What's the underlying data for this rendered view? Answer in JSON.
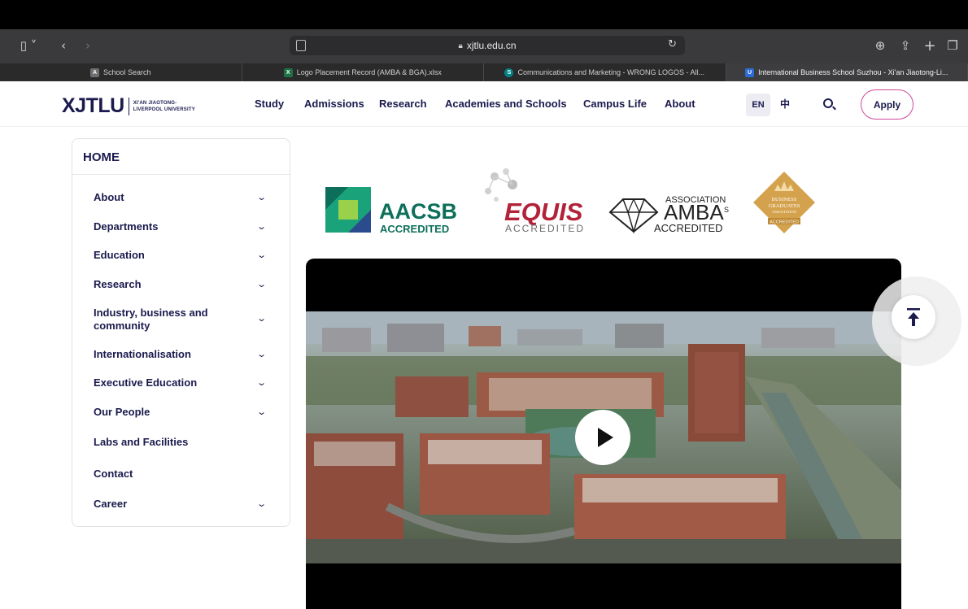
{
  "browser": {
    "url": "xjtlu.edu.cn",
    "tabs": [
      {
        "label": "School Search",
        "favicon_letter": "A",
        "favicon_color": "#6d6d72"
      },
      {
        "label": "Logo Placement Record (AMBA & BGA).xlsx",
        "favicon_letter": "X",
        "favicon_color": "#1e7145"
      },
      {
        "label": "Communications and Marketing - WRONG LOGOS - All...",
        "favicon_letter": "S",
        "favicon_color": "#038387"
      },
      {
        "label": "International Business School Suzhou - Xi'an Jiaotong-Li...",
        "favicon_letter": "U",
        "favicon_color": "#2b6cd4"
      }
    ]
  },
  "site": {
    "logo_main": "XJTLU",
    "logo_sub_1": "XI'AN JIAOTONG-",
    "logo_sub_2": "LIVERPOOL UNIVERSITY",
    "nav": [
      "Study",
      "Admissions",
      "Research",
      "Academies and Schools",
      "Campus Life",
      "About"
    ],
    "lang_en": "EN",
    "lang_zh": "中",
    "apply": "Apply"
  },
  "sidebar": {
    "home": "HOME",
    "items": [
      {
        "label": "About",
        "expandable": true
      },
      {
        "label": "Departments",
        "expandable": true
      },
      {
        "label": "Education",
        "expandable": true
      },
      {
        "label": "Research",
        "expandable": true
      },
      {
        "label": "Industry, business and community",
        "expandable": true
      },
      {
        "label": "Internationalisation",
        "expandable": true
      },
      {
        "label": "Executive Education",
        "expandable": true
      },
      {
        "label": "Our People",
        "expandable": true
      },
      {
        "label": "Labs and Facilities",
        "expandable": false
      },
      {
        "label": "Contact",
        "expandable": false
      },
      {
        "label": "Career",
        "expandable": true
      }
    ]
  },
  "accreditations": {
    "aacsb": {
      "name": "AACSB",
      "sub": "ACCREDITED",
      "color": "#1f8a70"
    },
    "equis": {
      "name": "EQUIS",
      "sub": "ACCREDITED",
      "color": "#b2233a"
    },
    "amba": {
      "prefix": "ASSOCIATION",
      "name": "AMBA",
      "suffix": "S",
      "sub": "ACCREDITED"
    },
    "bga": {
      "line1": "BUSINESS",
      "line2": "GRADUATES",
      "line3": "ASSOCIATION",
      "sub": "ACCREDITED",
      "color": "#d4a24c"
    }
  },
  "colors": {
    "brand": "#1a1a4e",
    "apply_border": "#d04a9a"
  }
}
